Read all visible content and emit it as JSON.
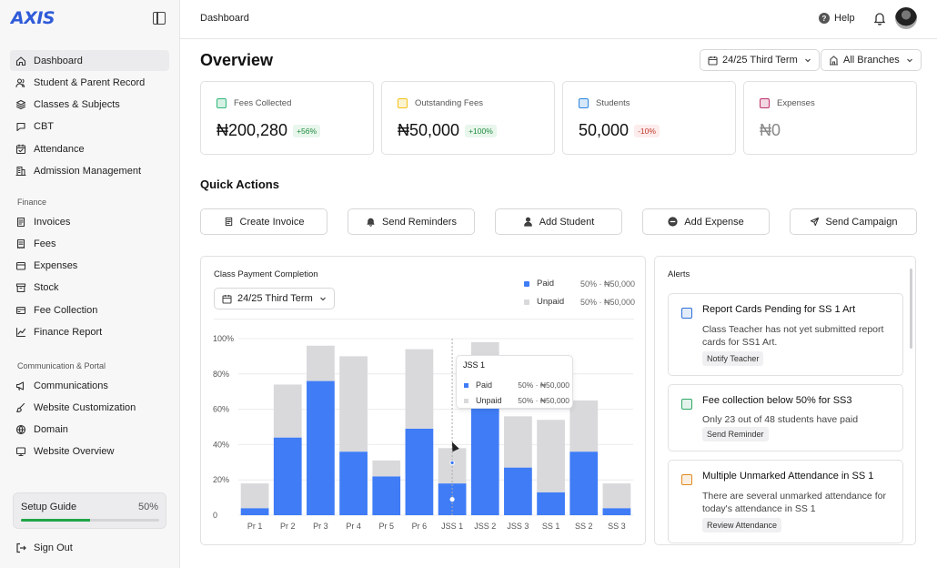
{
  "app": {
    "logo": "AXIS"
  },
  "sidebar": {
    "main_items": [
      {
        "label": "Dashboard",
        "icon": "home-icon",
        "active": true
      },
      {
        "label": "Student & Parent Record",
        "icon": "users-icon"
      },
      {
        "label": "Classes & Subjects",
        "icon": "layers-icon"
      },
      {
        "label": "CBT",
        "icon": "chat-icon"
      },
      {
        "label": "Attendance",
        "icon": "calendar-check-icon"
      },
      {
        "label": "Admission Management",
        "icon": "building-icon"
      }
    ],
    "finance_label": "Finance",
    "finance_items": [
      {
        "label": "Invoices",
        "icon": "invoice-icon"
      },
      {
        "label": "Fees",
        "icon": "receipt-icon"
      },
      {
        "label": "Expenses",
        "icon": "wallet-icon"
      },
      {
        "label": "Stock",
        "icon": "archive-icon"
      },
      {
        "label": "Fee Collection",
        "icon": "card-icon"
      },
      {
        "label": "Finance Report",
        "icon": "chart-line-icon"
      }
    ],
    "comm_label": "Communication & Portal",
    "comm_items": [
      {
        "label": "Communications",
        "icon": "megaphone-icon"
      },
      {
        "label": "Website Customization",
        "icon": "brush-icon"
      },
      {
        "label": "Domain",
        "icon": "globe-icon"
      },
      {
        "label": "Website Overview",
        "icon": "monitor-icon"
      }
    ],
    "setup": {
      "title": "Setup Guide",
      "percent_label": "50%",
      "progress": 0.5
    },
    "sign_out": "Sign Out"
  },
  "topbar": {
    "breadcrumb": "Dashboard",
    "help": "Help"
  },
  "overview": {
    "title": "Overview",
    "term_select": "24/25 Third Term",
    "branch_select": "All Branches"
  },
  "stats": [
    {
      "label": "Fees Collected",
      "value": "₦200,280",
      "badge": "+56%",
      "trend": "up",
      "icon_color": "#2fb87a"
    },
    {
      "label": "Outstanding Fees",
      "value": "₦50,000",
      "badge": "+100%",
      "trend": "up",
      "icon_color": "#f2c21b"
    },
    {
      "label": "Students",
      "value": "50,000",
      "badge": "-10%",
      "trend": "down",
      "icon_color": "#2e86de"
    },
    {
      "label": "Expenses",
      "value": "₦0",
      "badge": "",
      "trend": "none",
      "icon_color": "#c0306b"
    }
  ],
  "quick_actions": {
    "title": "Quick Actions",
    "buttons": [
      {
        "label": "Create Invoice",
        "icon": "invoice-icon"
      },
      {
        "label": "Send Reminders",
        "icon": "bell-icon"
      },
      {
        "label": "Add Student",
        "icon": "user-icon"
      },
      {
        "label": "Add Expense",
        "icon": "minus-circle-icon"
      },
      {
        "label": "Send Campaign",
        "icon": "send-icon"
      }
    ]
  },
  "chart_panel": {
    "title": "Class Payment Completion",
    "term_select": "24/25 Third Term",
    "legend": [
      {
        "label": "Paid",
        "value": "50% · ₦50,000",
        "color": "#3f7cf6"
      },
      {
        "label": "Unpaid",
        "value": "50% · ₦50,000",
        "color": "#d9d9dc"
      }
    ],
    "tooltip": {
      "title": "JSS 1",
      "rows": [
        {
          "label": "Paid",
          "value": "50% · ₦50,000",
          "color": "#3f7cf6"
        },
        {
          "label": "Unpaid",
          "value": "50% · ₦50,000",
          "color": "#d9d9dc"
        }
      ]
    }
  },
  "chart_data": {
    "type": "bar",
    "stacked": true,
    "categories": [
      "Pr 1",
      "Pr 2",
      "Pr 3",
      "Pr 4",
      "Pr 5",
      "Pr 6",
      "JSS 1",
      "JSS 2",
      "JSS 3",
      "SS 1",
      "SS 2",
      "SS 3"
    ],
    "series": [
      {
        "name": "Paid",
        "color": "#3f7cf6",
        "values": [
          4,
          44,
          76,
          36,
          22,
          49,
          18,
          86,
          27,
          13,
          36,
          4
        ]
      },
      {
        "name": "Unpaid",
        "color": "#d9d9dc",
        "values": [
          14,
          30,
          20,
          54,
          9,
          45,
          20,
          12,
          29,
          41,
          29,
          14
        ]
      }
    ],
    "y_ticks": [
      "0",
      "20%",
      "40%",
      "60%",
      "80%",
      "100%"
    ],
    "ylim": [
      0,
      100
    ],
    "grid": true,
    "legend_position": "top-right"
  },
  "alerts": {
    "title": "Alerts",
    "items": [
      {
        "title": "Report Cards Pending for SS 1 Art",
        "body": "Class Teacher has not yet submitted report cards for SS1 Art.",
        "action": "Notify Teacher",
        "icon_color": "#2e6fd8"
      },
      {
        "title": "Fee collection below 50% for SS3",
        "body": "Only 23 out of 48 students have paid",
        "action": "Send Reminder",
        "icon_color": "#2fa866"
      },
      {
        "title": "Multiple Unmarked Attendance in SS 1",
        "body": "There are several unmarked attendance for today's attendance in SS 1",
        "action": "Review Attendance",
        "icon_color": "#e08a1e"
      }
    ]
  }
}
